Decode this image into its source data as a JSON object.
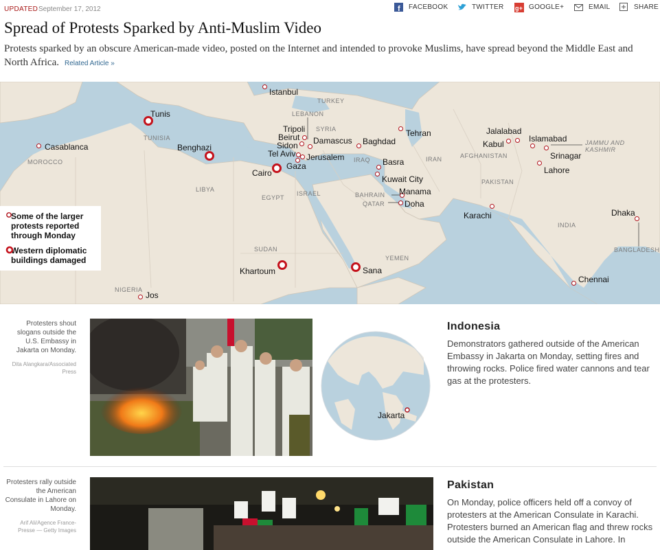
{
  "header": {
    "updated_label": "UPDATED",
    "updated_date": "September 17, 2012",
    "share": [
      {
        "label": "FACEBOOK",
        "icon": "facebook-icon"
      },
      {
        "label": "TWITTER",
        "icon": "twitter-icon"
      },
      {
        "label": "GOOGLE+",
        "icon": "google-plus-icon"
      },
      {
        "label": "EMAIL",
        "icon": "email-icon"
      },
      {
        "label": "SHARE",
        "icon": "plus-icon"
      }
    ]
  },
  "article": {
    "title": "Spread of Protests Sparked by Anti-Muslim Video",
    "summary": "Protests sparked by an obscure American-made video, posted on the Internet and intended to provoke Muslims, have spread beyond the Middle East and North Africa.",
    "related_link": "Related Article »"
  },
  "map": {
    "regions": [
      "TURKEY",
      "LEBANON",
      "SYRIA",
      "TUNISIA",
      "MOROCCO",
      "LIBYA",
      "EGYPT",
      "ISRAEL",
      "IRAQ",
      "IRAN",
      "AFGHANISTAN",
      "PAKISTAN",
      "INDIA",
      "JAMMU AND",
      "KASHMIR",
      "BAHRAIN",
      "QATAR",
      "SUDAN",
      "YEMEN",
      "NIGERIA",
      "BANGLADESH"
    ],
    "cities": [
      "Istanbul",
      "Tunis",
      "Casablanca",
      "Benghazi",
      "Tripoli",
      "Beirut",
      "Sidon",
      "Tel Aviv",
      "Damascus",
      "Jerusalem",
      "Gaza",
      "Cairo",
      "Baghdad",
      "Tehran",
      "Basra",
      "Kuwait City",
      "Manama",
      "Doha",
      "Jalalabad",
      "Kabul",
      "Islamabad",
      "Srinagar",
      "Lahore",
      "Karachi",
      "Dhaka",
      "Khartoum",
      "Sana",
      "Jos",
      "Chennai"
    ],
    "legend": {
      "protest": "Some of the larger protests reported through Monday",
      "damaged": "Western diplomatic buildings damaged"
    },
    "colors": {
      "water": "#b9d1de",
      "land": "#ede6da",
      "marker": "#c4121c"
    }
  },
  "stories": [
    {
      "caption": "Protesters shout slogans outside the U.S. Embassy in Jakarta on Monday.",
      "credit": "Dita Alangkara/Associated Press",
      "globe_label": "Jakarta",
      "heading": "Indonesia",
      "text": "Demonstrators gathered outside of the American Embassy in Jakarta on Monday, setting fires and throwing rocks. Police fired water cannons and tear gas at the protesters."
    },
    {
      "caption": "Protesters rally outside the American Consulate in Lahore on Monday.",
      "credit": "Arif Ali/Agence France-Presse — Getty Images",
      "heading": "Pakistan",
      "text": "On Monday, police officers held off a convoy of protesters at the American Consulate in Karachi. Protesters burned an American flag and threw rocks outside the American Consulate in Lahore. In"
    }
  ]
}
